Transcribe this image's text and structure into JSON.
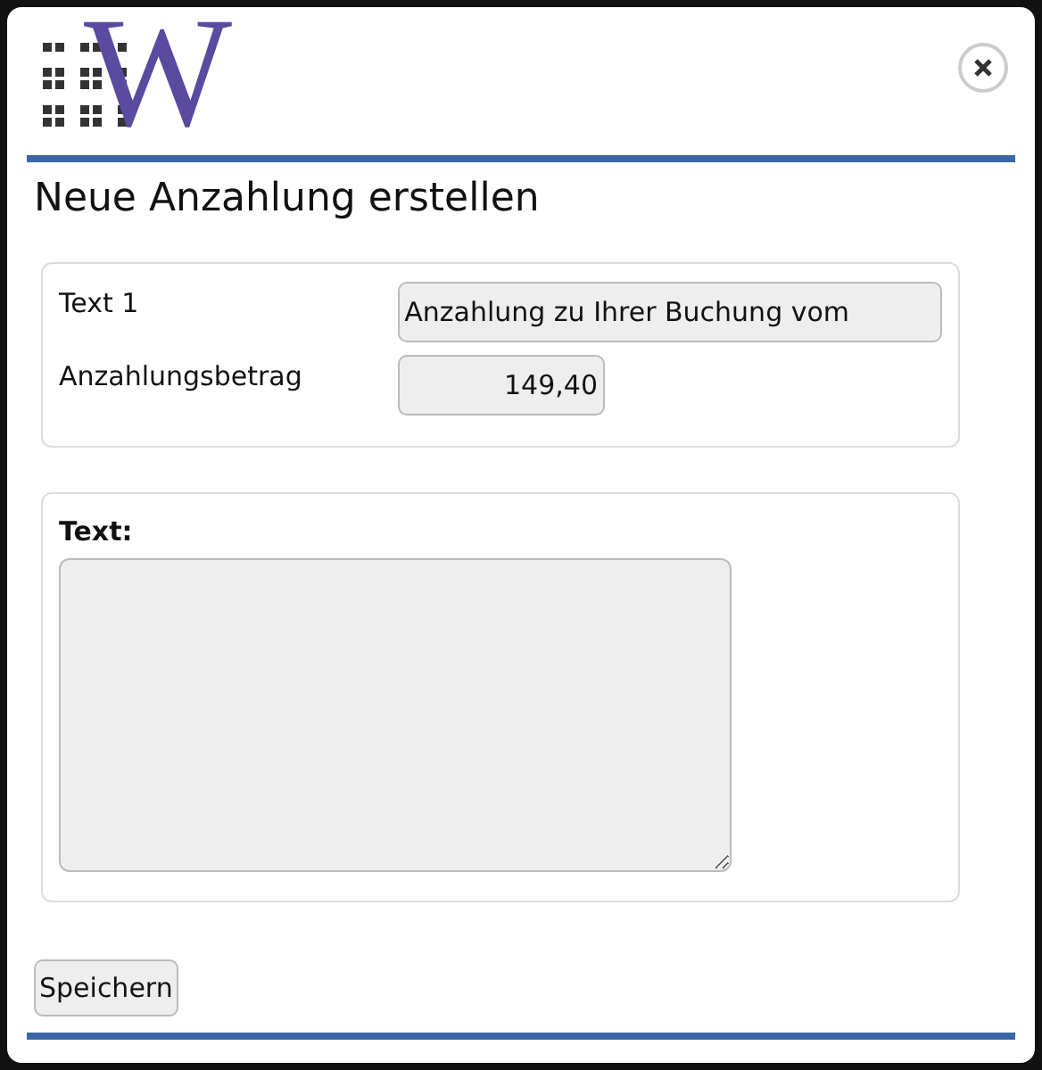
{
  "logo": {
    "letter": "W"
  },
  "title": "Neue Anzahlung erstellen",
  "fields": [
    {
      "label": "Text 1",
      "value": "Anzahlung zu Ihrer Buchung vom",
      "kind": "wide"
    },
    {
      "label": "Anzahlungsbetrag",
      "value": "149,40",
      "kind": "amount"
    }
  ],
  "text_section": {
    "label": "Text:"
  },
  "buttons": [
    "Speichern"
  ]
}
